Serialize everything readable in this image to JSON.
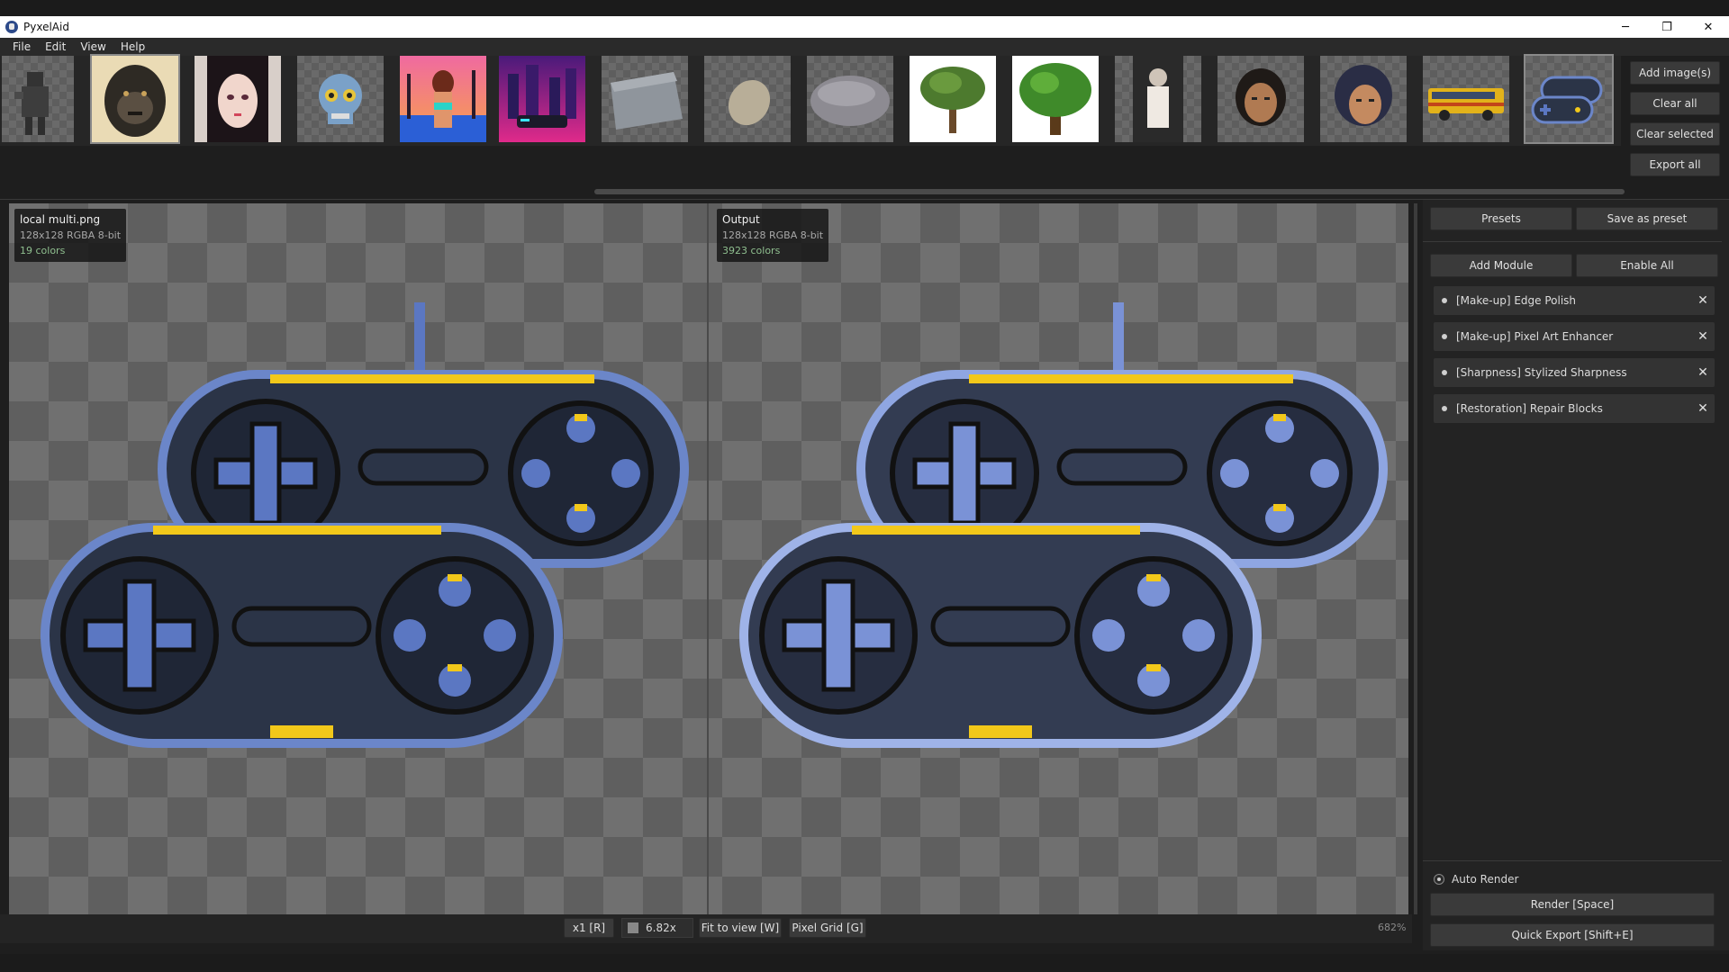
{
  "window": {
    "title": "PyxelAid",
    "minimize": "─",
    "maximize": "❐",
    "close": "✕"
  },
  "menu": [
    "File",
    "Edit",
    "View",
    "Help"
  ],
  "thumbnails": [
    {
      "name": "ninja"
    },
    {
      "name": "gorilla"
    },
    {
      "name": "anime-woman"
    },
    {
      "name": "skull"
    },
    {
      "name": "beach-woman"
    },
    {
      "name": "neon-city-car"
    },
    {
      "name": "rock-block"
    },
    {
      "name": "pebble"
    },
    {
      "name": "stone"
    },
    {
      "name": "tree-1"
    },
    {
      "name": "tree-2"
    },
    {
      "name": "cat-person"
    },
    {
      "name": "face-1"
    },
    {
      "name": "face-2"
    },
    {
      "name": "school-bus"
    },
    {
      "name": "controllers"
    }
  ],
  "strip_actions": {
    "add": "Add image(s)",
    "clear_all": "Clear all",
    "clear_selected": "Clear selected",
    "export_all": "Export all"
  },
  "input_info": {
    "name": "local multi.png",
    "meta": "128x128  RGBA  8-bit",
    "colors": "19 colors"
  },
  "output_info": {
    "name": "Output",
    "meta": "128x128  RGBA  8-bit",
    "colors": "3923 colors"
  },
  "zoom": {
    "x1": "x1 [R]",
    "value": "6.82x",
    "fit": "Fit to view [W]",
    "grid": "Pixel Grid [G]",
    "percent": "682%"
  },
  "panel": {
    "presets": "Presets",
    "save_preset": "Save as preset",
    "add_module": "Add Module",
    "enable_all": "Enable All",
    "modules": [
      "[Make-up] Edge Polish",
      "[Make-up] Pixel Art Enhancer",
      "[Sharpness] Stylized Sharpness",
      "[Restoration] Repair Blocks"
    ],
    "close_glyph": "✕",
    "auto_render": "Auto Render",
    "render": "Render  [Space]",
    "quick_export": "Quick Export  [Shift+E]"
  },
  "colors": {
    "controller_body": "#2b3447",
    "controller_rim": "#6b86c9",
    "accent_yellow": "#f2c81a",
    "button_blue": "#5b77c2"
  }
}
